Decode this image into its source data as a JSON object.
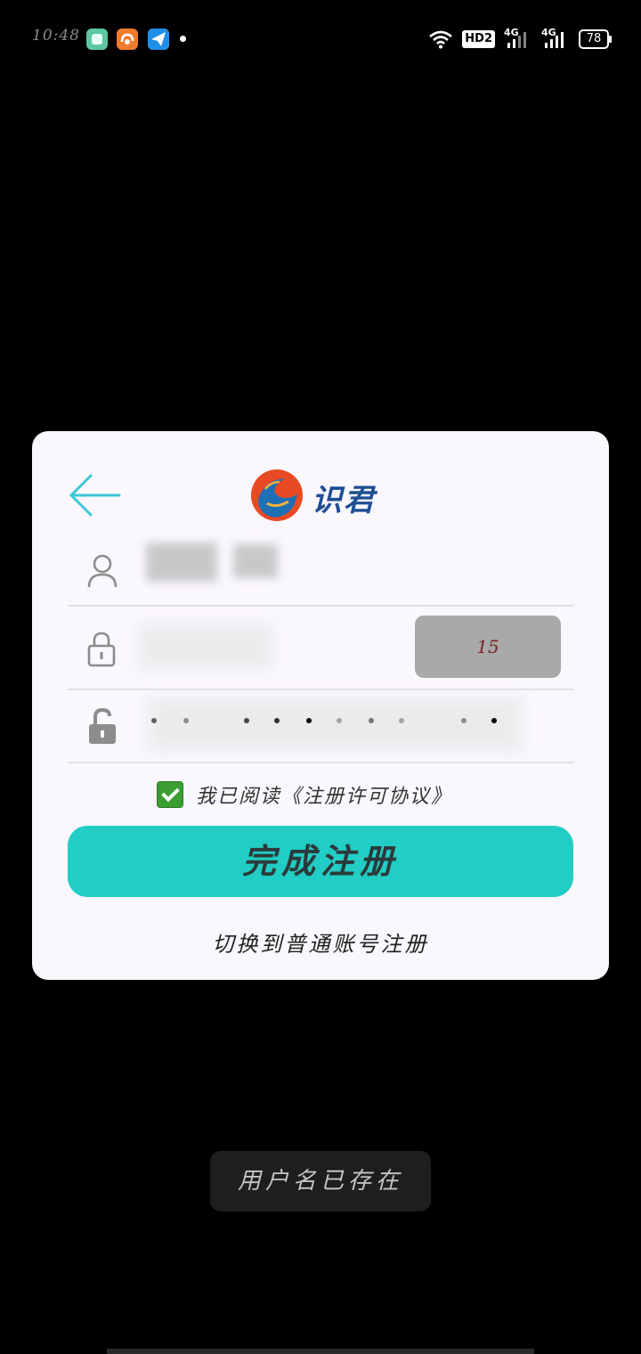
{
  "status_bar": {
    "time": "10:48",
    "hd_label": "HD2",
    "signal1_label": "4G",
    "signal2_label": "4G",
    "battery": "78"
  },
  "card": {
    "brand_name": "识君",
    "code_button_label": "15",
    "agreement_text": "我已阅读《注册许可协议》",
    "submit_label": "完成注册",
    "switch_link": "切换到普通账号注册"
  },
  "toast": {
    "message": "用户名已存在"
  },
  "icons": {
    "back": "arrow-left-icon",
    "user": "user-icon",
    "lock_outline": "lock-outline-icon",
    "lock_filled": "lock-filled-icon",
    "check": "checkbox-checked-icon"
  },
  "colors": {
    "accent": "#21cdc5",
    "back_arrow": "#3cc7d8",
    "brand": "#1f4e92",
    "card_bg": "#faf7fd",
    "code_button_bg": "#a9a9a9",
    "checkbox": "#3a9e33"
  }
}
